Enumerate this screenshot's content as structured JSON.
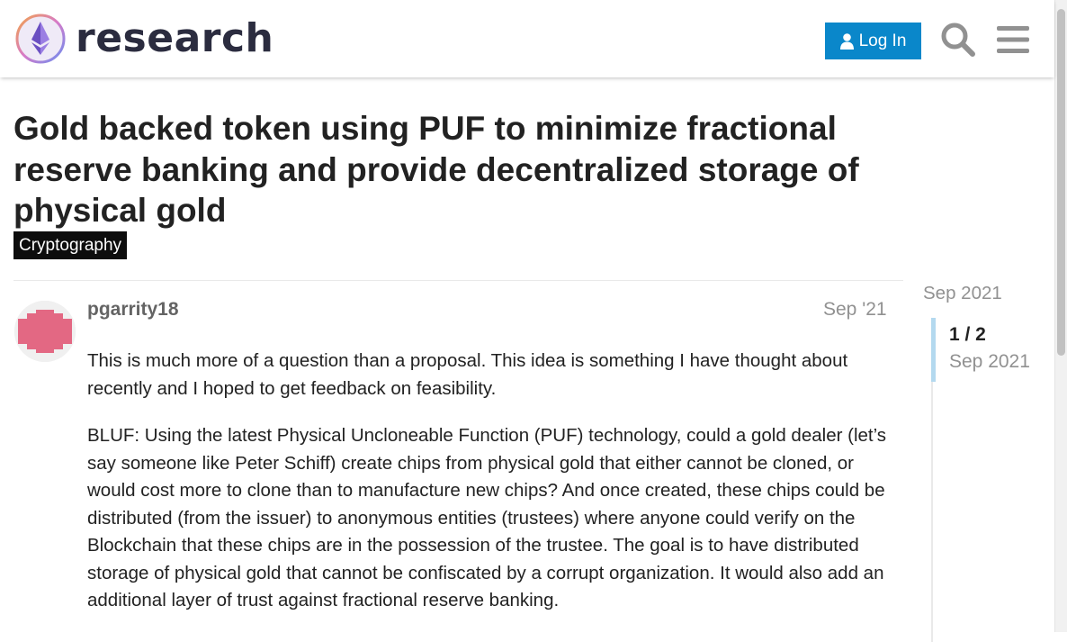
{
  "header": {
    "logo_text": "research",
    "login_label": "Log In",
    "search_icon": "search-icon",
    "menu_icon": "hamburger-menu-icon",
    "colors": {
      "accent": "#0a87ca",
      "logo_text": "#2b2c3f"
    }
  },
  "topic": {
    "title": "Gold backed token using PUF to minimize fractional reserve banking and provide decentralized storage of physical gold",
    "category": "Cryptography"
  },
  "post": {
    "username": "pgarrity18",
    "date": "Sep '21",
    "avatar_color": "#e36883",
    "paragraphs": [
      "This is much more of a question than a proposal. This idea is something I have thought about recently and I hoped to get feedback on feasibility.",
      "BLUF: Using the latest Physical Uncloneable Function (PUF) technology, could a gold dealer (let’s say someone like Peter Schiff) create chips from physical gold that either cannot be cloned, or would cost more to clone than to manufacture new chips? And once created, these chips could be distributed (from the issuer) to anonymous entities (trustees) where anyone could verify on the Blockchain that these chips are in the possession of the trustee. The goal is to have distributed storage of physical gold that cannot be confiscated by a corrupt organization. It would also add an additional layer of trust against fractional reserve banking."
    ]
  },
  "timeline": {
    "start_date": "Sep 2021",
    "position": "1 / 2",
    "current_date": "Sep 2021"
  }
}
